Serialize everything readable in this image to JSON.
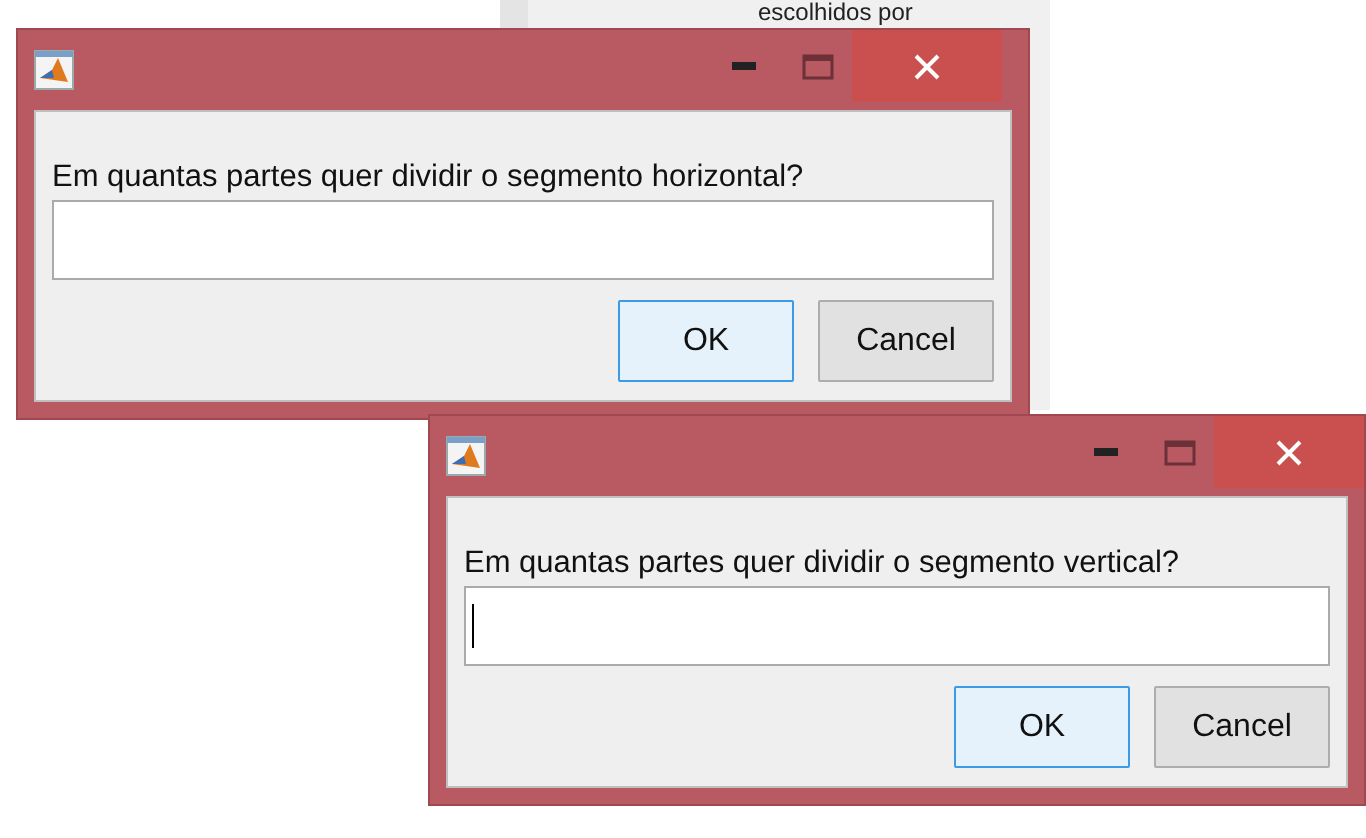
{
  "background": {
    "text": "escolhidos por"
  },
  "dialogs": [
    {
      "prompt": "Em quantas partes quer dividir o segmento horizontal?",
      "field": {
        "focused": false
      },
      "buttons": [
        {
          "label": "OK",
          "default": true
        },
        {
          "label": "Cancel",
          "default": false
        }
      ]
    },
    {
      "prompt": "Em quantas partes quer dividir o segmento vertical?",
      "field": {
        "focused": true
      },
      "buttons": [
        {
          "label": "OK",
          "default": true
        },
        {
          "label": "Cancel",
          "default": false
        }
      ]
    }
  ]
}
